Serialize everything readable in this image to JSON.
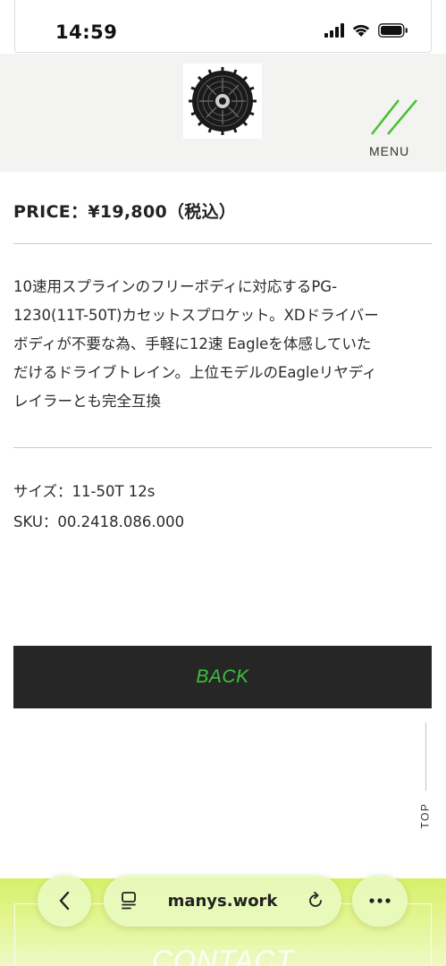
{
  "status_bar": {
    "time": "14:59"
  },
  "header": {
    "menu_label": "MENU"
  },
  "product": {
    "price": "PRICE：¥19,800（税込）",
    "description_lines": [
      "10速用スプラインのフリーボディに対応するPG-",
      "1230(11T-50T)カセットスプロケット。XDドライバー",
      "ボディが不要な為、手軽に12速 Eagleを体感していた",
      "だけるドライブトレイン。上位モデルのEagleリヤディ",
      "レイラーとも完全互換"
    ],
    "size": "サイズ：11-50T 12s",
    "sku": "SKU：00.2418.086.000"
  },
  "actions": {
    "back_label": "BACK",
    "top_label": "TOP"
  },
  "footer": {
    "contact_label": "CONTACT"
  },
  "browser": {
    "url": "manys.work"
  },
  "colors": {
    "accent": "#3dc13a",
    "button_bg": "#262626",
    "footer_bg": "#d6f06a"
  }
}
